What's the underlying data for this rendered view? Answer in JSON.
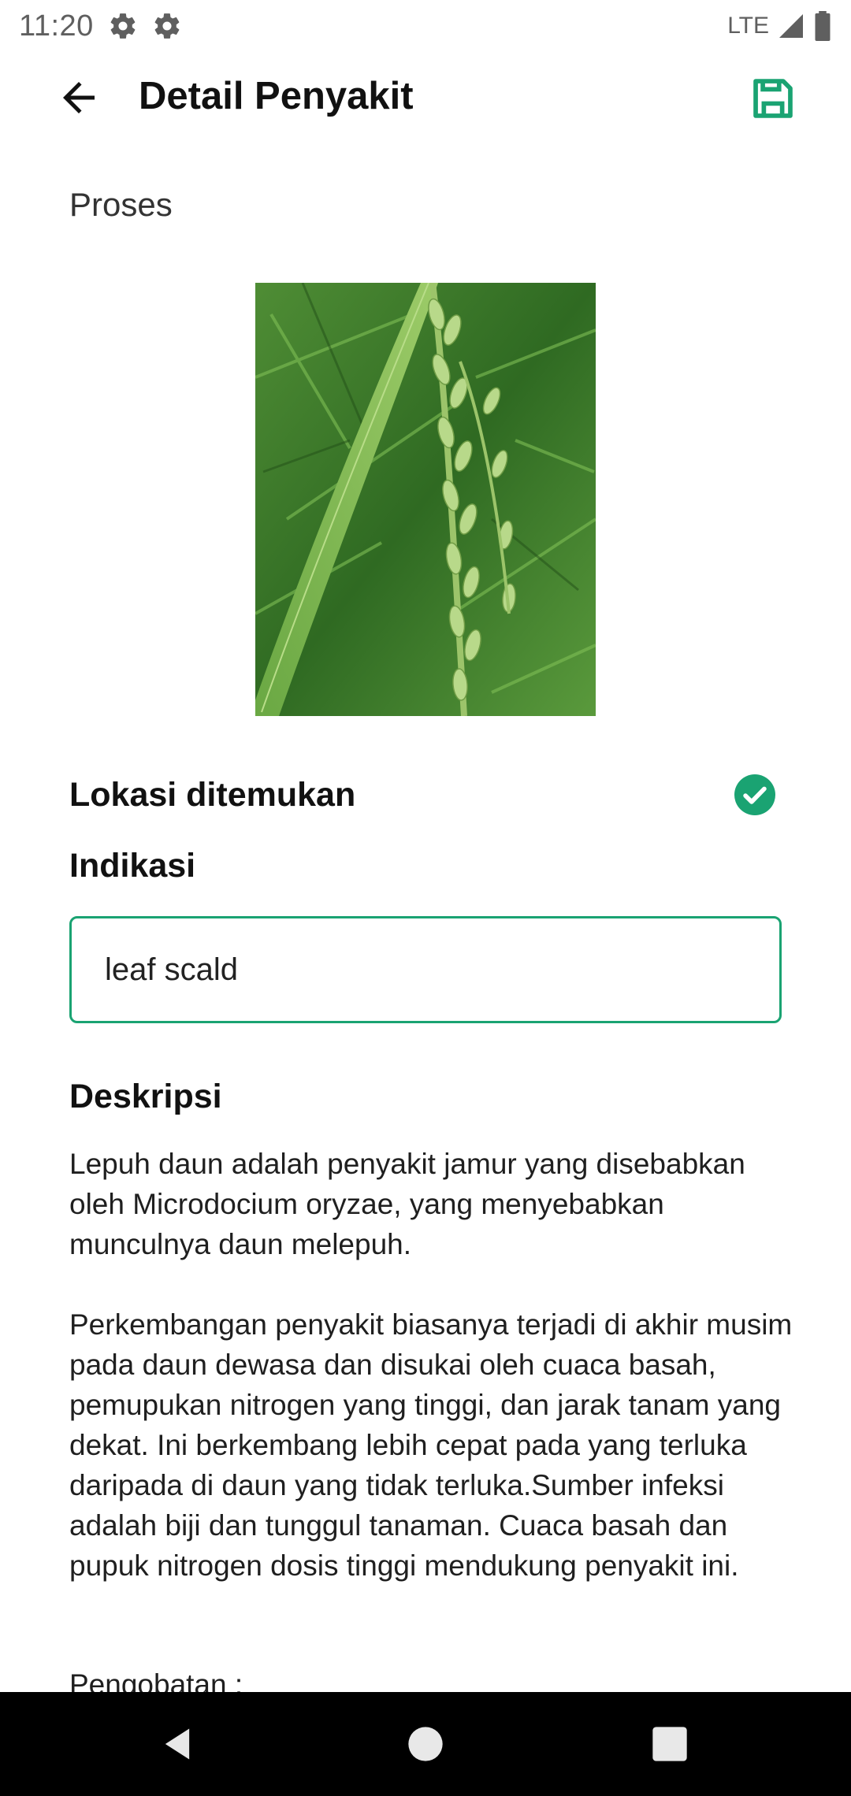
{
  "status_bar": {
    "time": "11:20",
    "network": "LTE",
    "icons": [
      "gear-icon",
      "gear-icon",
      "signal-icon",
      "battery-icon"
    ]
  },
  "app_bar": {
    "title": "Detail Penyakit",
    "back_icon": "arrow-left-icon",
    "save_icon": "floppy-disk-icon",
    "accent_color": "#1aa372"
  },
  "content": {
    "proses_label": "Proses",
    "location_label": "Lokasi ditemukan",
    "location_status_icon": "check-circle-icon",
    "indikasi_label": "Indikasi",
    "indikasi_value": "leaf scald",
    "deskripsi_label": "Deskripsi",
    "deskripsi_paragraphs": [
      "Lepuh daun adalah penyakit jamur yang disebabkan oleh Microdocium oryzae, yang menyebabkan munculnya daun melepuh.",
      "Perkembangan penyakit biasanya terjadi di akhir musim pada daun dewasa dan disukai oleh cuaca basah, pemupukan nitrogen yang tinggi, dan jarak tanam yang dekat. Ini berkembang lebih cepat pada yang terluka daripada di daun yang tidak terluka.Sumber infeksi adalah biji dan tunggul tanaman. Cuaca basah dan pupuk nitrogen dosis tinggi mendukung penyakit ini."
    ],
    "pengobatan_label": "Pengobatan :"
  },
  "nav_bar": {
    "back_icon": "nav-back-icon",
    "home_icon": "nav-home-icon",
    "recents_icon": "nav-recents-icon"
  }
}
